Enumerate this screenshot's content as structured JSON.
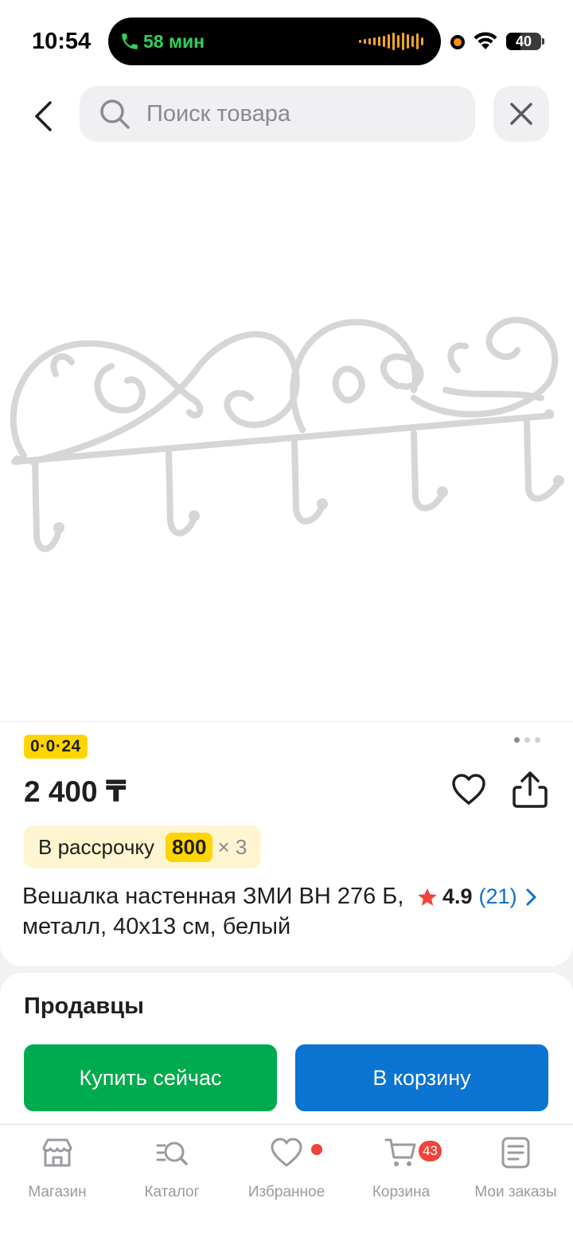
{
  "status_bar": {
    "time": "10:54",
    "call_duration": "58 мин",
    "battery": "40",
    "battery_level": 0.4
  },
  "header": {
    "search_placeholder": "Поиск товара",
    "back_icon": "chevron-left-icon",
    "close_icon": "close-icon"
  },
  "product": {
    "promo_badge": "0·0·24",
    "price": "2 400 ₸",
    "installment_label": "В рассрочку",
    "installment_amount": "800",
    "installment_multiplier": "× 3",
    "title": "Вешалка настенная ЗМИ ВН 276 Б, металл, 40х13 см, белый",
    "rating": "4.9",
    "reviews_count": "(21)",
    "image_pages": 3,
    "image_current": 1
  },
  "sellers": {
    "title": "Продавцы",
    "buy_now": "Купить сейчас",
    "add_to_cart": "В корзину"
  },
  "nav": {
    "items": [
      {
        "label": "Магазин",
        "icon": "store-icon"
      },
      {
        "label": "Каталог",
        "icon": "catalog-search-icon"
      },
      {
        "label": "Избранное",
        "icon": "heart-icon"
      },
      {
        "label": "Корзина",
        "icon": "cart-icon",
        "badge": "43"
      },
      {
        "label": "Мои заказы",
        "icon": "orders-icon"
      }
    ]
  },
  "colors": {
    "green": "#00ab4f",
    "blue": "#0a74d0",
    "yellow": "#ffd500",
    "badge_red": "#f0433a"
  }
}
